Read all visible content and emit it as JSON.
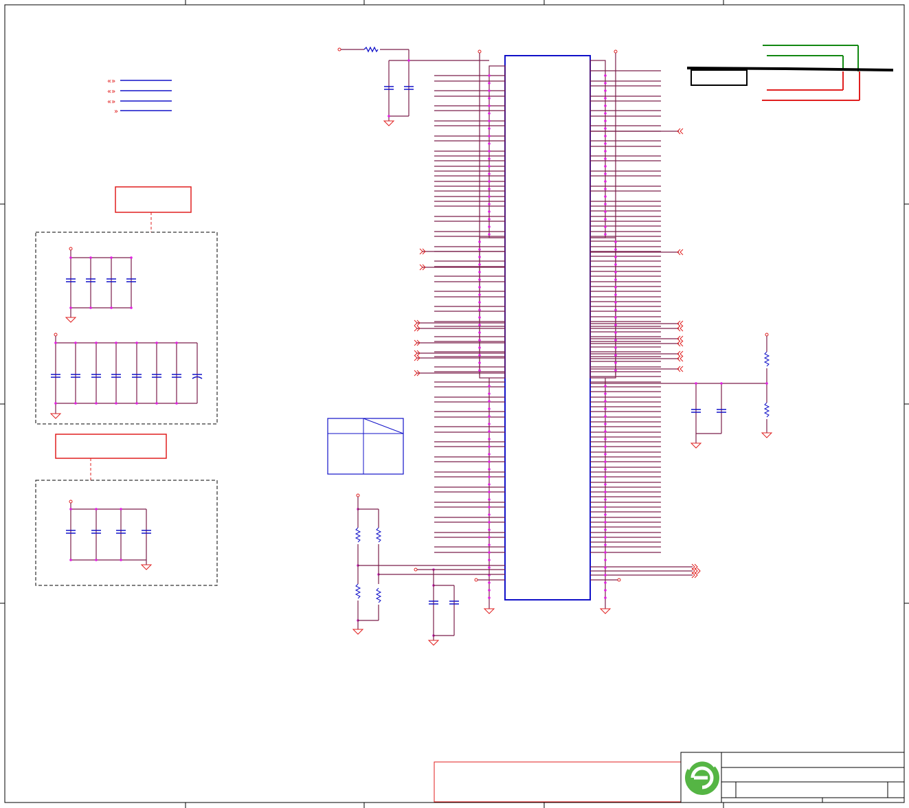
{
  "sheet": {
    "title": "",
    "colors": {
      "wire": "#7a1d4a",
      "component": "#1010c8",
      "power": "#e01e1e",
      "junction": "#e020e0",
      "note_green": "#118811",
      "logo_green": "#55b544",
      "border": "#000000"
    }
  },
  "title_block": {
    "logo_icon": "company-logo-icon",
    "rows": []
  }
}
